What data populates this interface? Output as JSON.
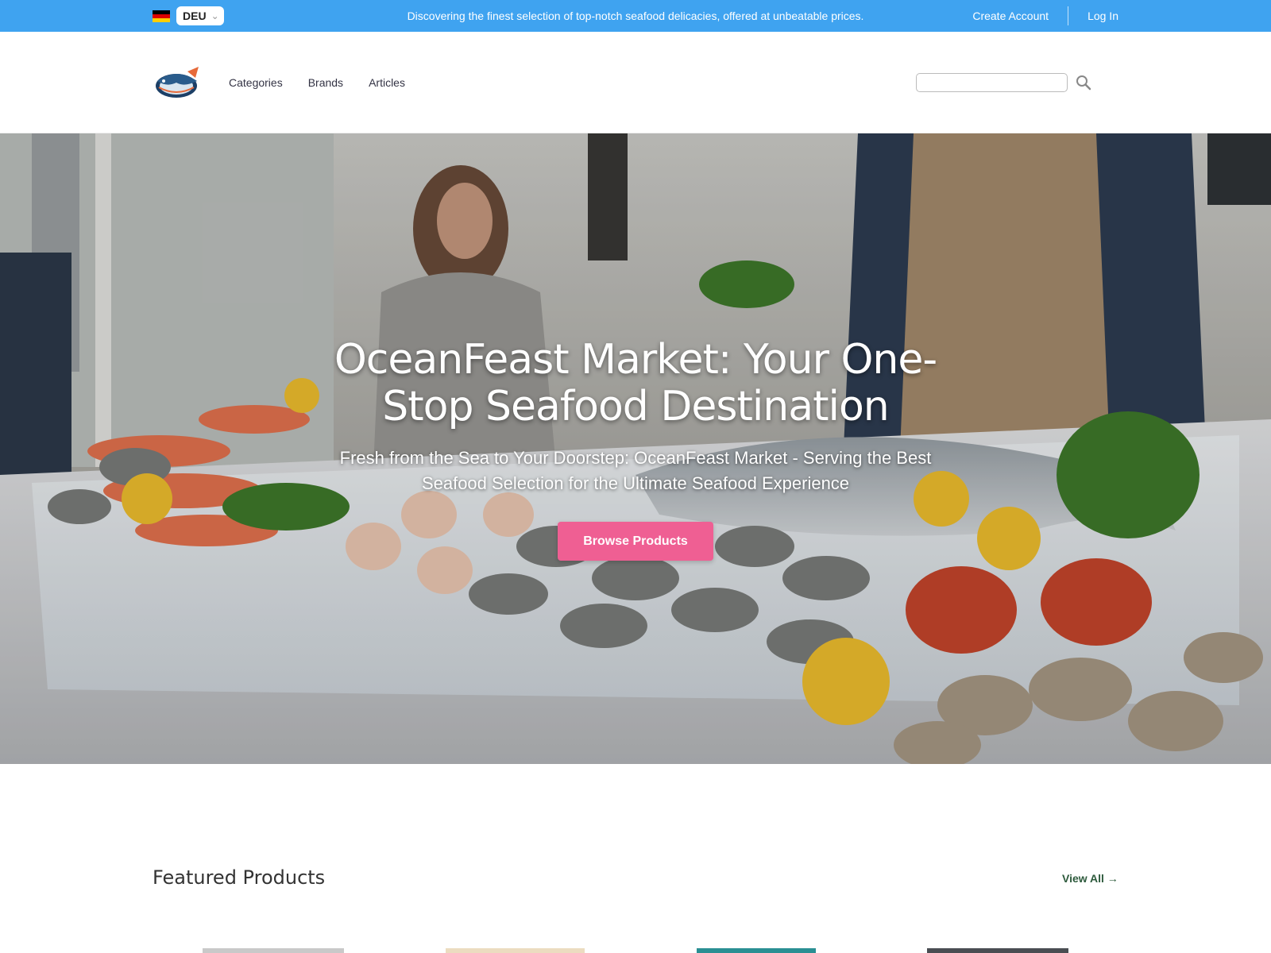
{
  "topbar": {
    "language": "DEU",
    "announcement": "Discovering the finest selection of top-notch seafood delicacies, offered at unbeatable prices.",
    "create_account": "Create Account",
    "log_in": "Log In"
  },
  "nav": {
    "categories": "Categories",
    "brands": "Brands",
    "articles": "Articles"
  },
  "search": {
    "placeholder": ""
  },
  "hero": {
    "title": "OceanFeast Market: Your One-Stop Seafood Destination",
    "subtitle": "Fresh from the Sea to Your Doorstep: OceanFeast Market - Serving the Best Seafood Selection for the Ultimate Seafood Experience",
    "cta": "Browse Products"
  },
  "featured": {
    "title": "Featured Products",
    "view_all": "View All →"
  },
  "colors": {
    "topbar": "#3fa3f0",
    "cta": "#ef5f93",
    "link": "#2d5a3c"
  },
  "icons": {
    "search": "search-icon",
    "chevron": "chevron-down-icon",
    "flag": "germany-flag-icon"
  }
}
